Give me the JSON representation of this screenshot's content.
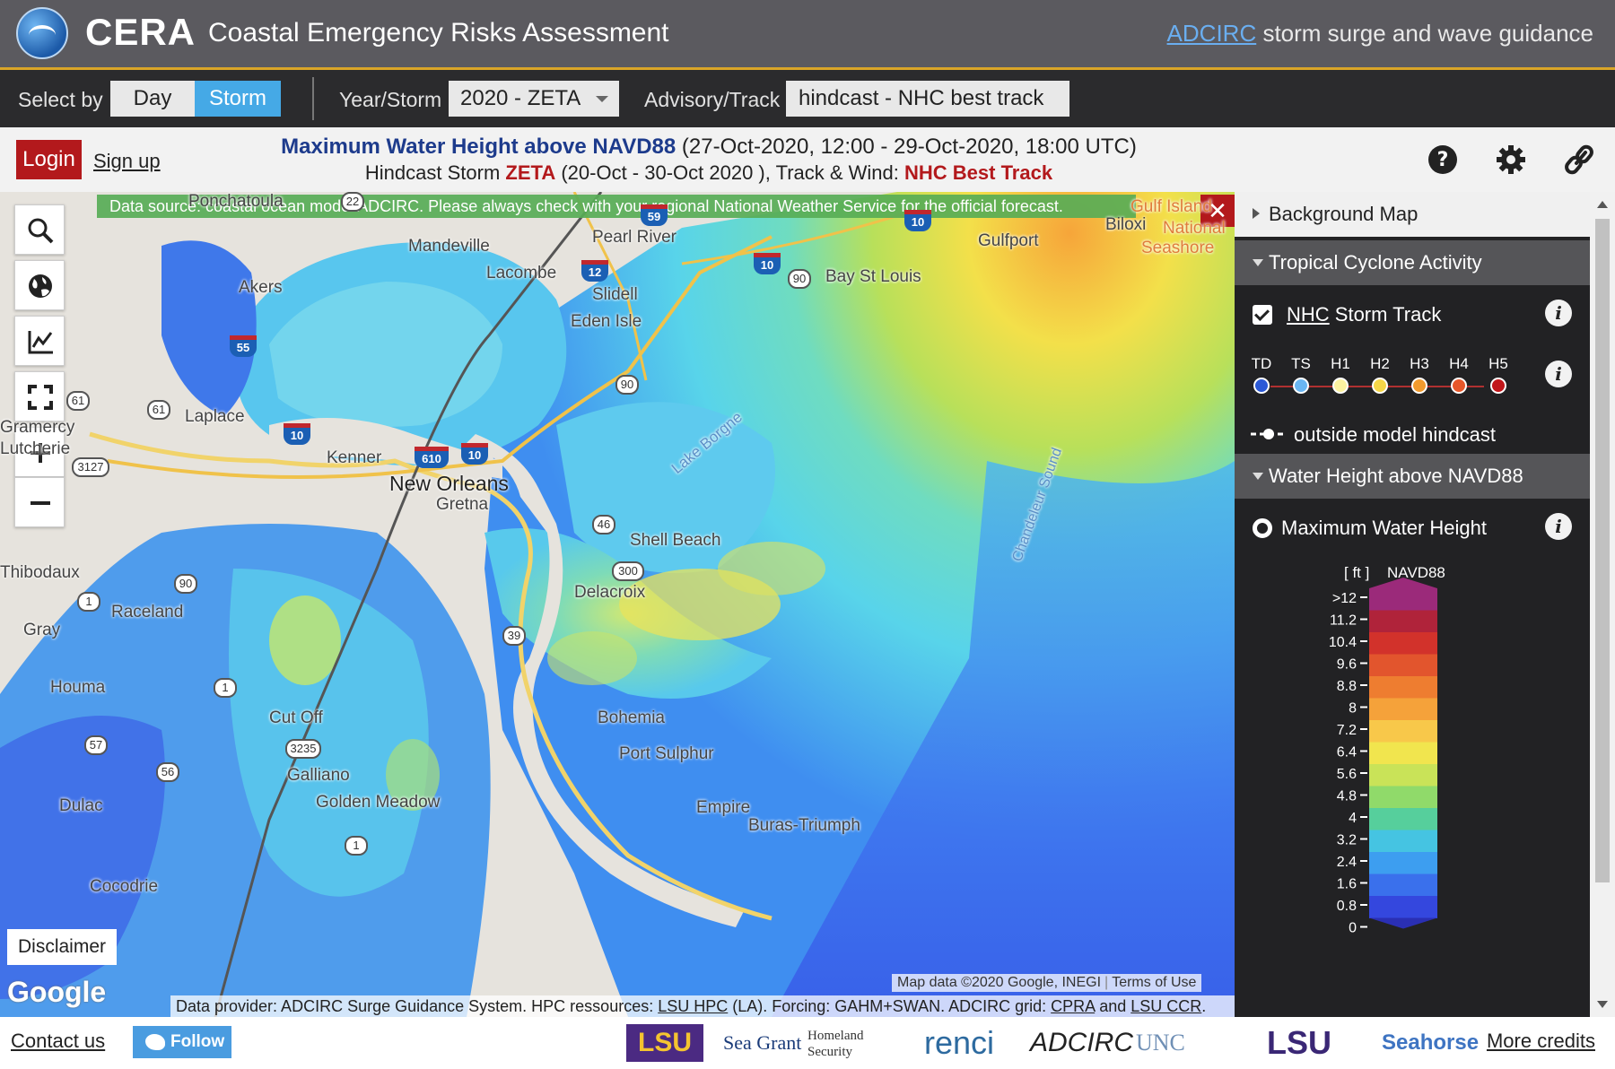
{
  "header": {
    "brand": "CERA",
    "title": "Coastal Emergency Risks Assessment",
    "right_link": "ADCIRC",
    "right_text": " storm surge and wave guidance"
  },
  "toolbar": {
    "select_by_label": "Select by",
    "day_label": "Day",
    "storm_label": "Storm",
    "year_storm_label": "Year/Storm",
    "year_storm_value": "2020 - ZETA",
    "advisory_label": "Advisory/Track",
    "advisory_value": "hindcast - NHC best track"
  },
  "infobar": {
    "login_label": "Login",
    "signup_label": "Sign up",
    "product": "Maximum Water Height above NAVD88",
    "product_range": " (27-Oct-2020, 12:00 - 29-Oct-2020, 18:00 UTC)",
    "sub_prefix": "Hindcast Storm ",
    "storm_name": "ZETA",
    "sub_middle": " (20-Oct - 30-Oct 2020 ), Track & Wind: ",
    "track_name": "NHC Best Track"
  },
  "map": {
    "banner": "Data source: coastal ocean model ADCIRC. Please always check with your regional National Weather Service for the official forecast.",
    "close_label": "✕",
    "disclaimer_label": "Disclaimer",
    "google_label": "Google",
    "map_data": "Map data ©2020 Google, INEGI",
    "terms": "Terms of Use",
    "provider_prefix": "Data provider: ADCIRC Surge Guidance System. HPC ressources: ",
    "provider_lsu_hpc": "LSU HPC",
    "provider_mid": " (LA). Forcing: GAHM+SWAN. ADCIRC grid: ",
    "provider_cpra": "CPRA",
    "provider_and": " and ",
    "provider_ccr": "LSU CCR",
    "provider_end": ".",
    "places": {
      "ponchatoula": "Ponchatoula",
      "mandeville": "Mandeville",
      "pearl_river": "Pearl River",
      "lacombe": "Lacombe",
      "slidell": "Slidell",
      "eden_isle": "Eden Isle",
      "akers": "Akers",
      "gulfport": "Gulfport",
      "bay_st_louis": "Bay St Louis",
      "biloxi": "Biloxi",
      "gulf_islands": "Gulf Island",
      "national": "National",
      "seashore": "Seashore",
      "laplace": "Laplace",
      "gramercy": "Gramercy",
      "lucherie": "Lutcherie",
      "kenner": "Kenner",
      "new_orleans": "New Orleans",
      "gretna": "Gretna",
      "lake_borgne": "Lake Borgne",
      "chandeleur_sound": "Chandeleur Sound",
      "shell_beach": "Shell Beach",
      "delacroix": "Delacroix",
      "thibodaux": "Thibodaux",
      "raceland": "Raceland",
      "gray": "Gray",
      "houma": "Houma",
      "cut_off": "Cut Off",
      "bohemia": "Bohemia",
      "port_sulphur": "Port Sulphur",
      "galliano": "Galliano",
      "golden_meadow": "Golden Meadow",
      "empire": "Empire",
      "buras": "Buras-Triumph",
      "dulac": "Dulac",
      "cocodrie": "Cocodrie"
    },
    "shields": {
      "s22": "22",
      "s59": "59",
      "s10a": "10",
      "s12": "12",
      "s10b": "10",
      "s90a": "90",
      "s55": "55",
      "s61a": "61",
      "s61b": "61",
      "s3127": "3127",
      "s10c": "10",
      "s610": "610",
      "s10d": "10",
      "s90b": "90",
      "s46": "46",
      "s300": "300",
      "s90c": "90",
      "s1a": "1",
      "s39": "39",
      "s1b": "1",
      "s57": "57",
      "s3235": "3235",
      "s56": "56",
      "s1c": "1"
    }
  },
  "sidepanel": {
    "background_map": "Background Map",
    "tropical_cyclone": "Tropical Cyclone Activity",
    "nhc_link": "NHC",
    "storm_track": " Storm Track",
    "categories": [
      "TD",
      "TS",
      "H1",
      "H2",
      "H3",
      "H4",
      "H5"
    ],
    "category_colors": [
      "#2b59d6",
      "#6ab6f2",
      "#fbf2a0",
      "#f5d648",
      "#f19a2d",
      "#e8572a",
      "#c1161a"
    ],
    "outside_label": "outside model hindcast",
    "water_height": "Water Height above NAVD88",
    "max_water": "Maximum Water Height",
    "legend_unit": "[ ft ]",
    "legend_datum": "NAVD88",
    "legend_ticks": [
      ">12",
      "11.2",
      "10.4",
      "9.6",
      "8.8",
      "8",
      "7.2",
      "6.4",
      "5.6",
      "4.8",
      "4",
      "3.2",
      "2.4",
      "1.6",
      "0.8",
      "0"
    ],
    "info_glyph": "i"
  },
  "footer": {
    "contact": "Contact us",
    "follow": "Follow",
    "sponsors": [
      "LSU",
      "Sea Grant",
      "Homeland Security",
      "renci",
      "ADCIRC",
      "UNC",
      "LSU",
      "Seahorse"
    ],
    "more_credits": "More credits"
  }
}
